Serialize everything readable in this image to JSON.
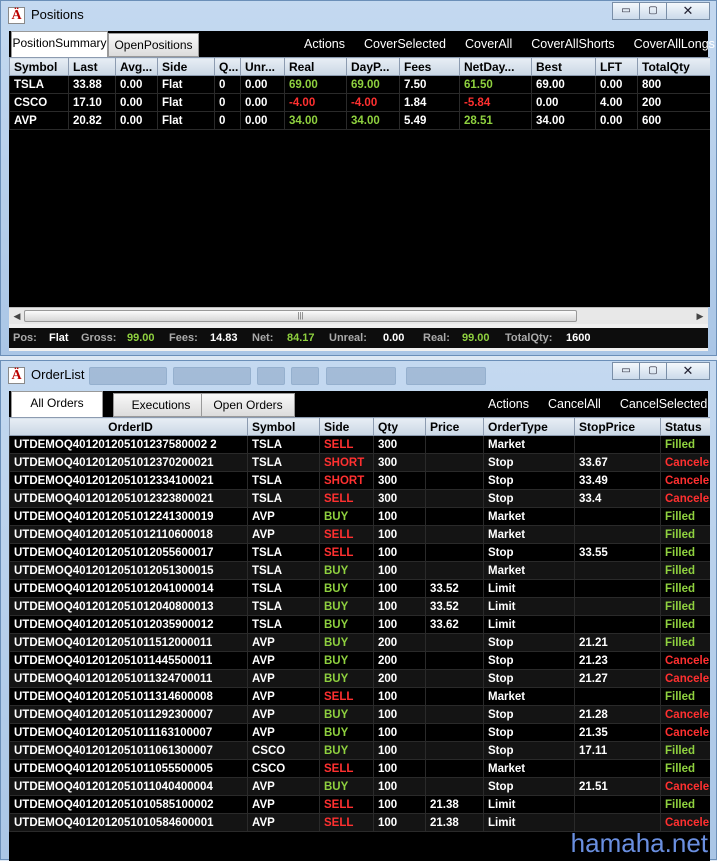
{
  "positions_window": {
    "title": "Positions",
    "app_icon_glyph": "Ä",
    "controls": {
      "minimize": "▭",
      "maximize": "▢",
      "close": "✕"
    },
    "tabs": [
      "PositionSummary",
      "OpenPositions"
    ],
    "actions": [
      "Actions",
      "CoverSelected",
      "CoverAll",
      "CoverAllShorts",
      "CoverAllLongs"
    ],
    "columns": [
      "Symbol",
      "Last",
      "Avg...",
      "Side",
      "Q...",
      "Unr...",
      "Real",
      "DayP...",
      "Fees",
      "NetDay...",
      "Best",
      "LFT",
      "TotalQty"
    ],
    "rows": [
      [
        "TSLA",
        "33.88",
        "0.00",
        "Flat",
        "0",
        "0.00",
        "69.00",
        "69.00",
        "7.50",
        "61.50",
        "69.00",
        "0.00",
        "800"
      ],
      [
        "CSCO",
        "17.10",
        "0.00",
        "Flat",
        "0",
        "0.00",
        "-4.00",
        "-4.00",
        "1.84",
        "-5.84",
        "0.00",
        "4.00",
        "200"
      ],
      [
        "AVP",
        "20.82",
        "0.00",
        "Flat",
        "0",
        "0.00",
        "34.00",
        "34.00",
        "5.49",
        "28.51",
        "34.00",
        "0.00",
        "600"
      ]
    ],
    "status": {
      "pos_label": "Pos:",
      "pos_value": "Flat",
      "gross_label": "Gross:",
      "gross_value": "99.00",
      "fees_label": "Fees:",
      "fees_value": "14.83",
      "net_label": "Net:",
      "net_value": "84.17",
      "unreal_label": "Unreal:",
      "unreal_value": "0.00",
      "real_label": "Real:",
      "real_value": "99.00",
      "totalqty_label": "TotalQty:",
      "totalqty_value": "1600"
    },
    "scroll_grip": "|||"
  },
  "orders_window": {
    "title": "OrderList",
    "app_icon_glyph": "Ä",
    "controls": {
      "minimize": "▭",
      "maximize": "▢",
      "close": "✕"
    },
    "tabs": [
      "All Orders",
      "Executions",
      "Open Orders"
    ],
    "actions": [
      "Actions",
      "CancelAll",
      "CancelSelected"
    ],
    "columns": [
      "OrderID",
      "Symbol",
      "Side",
      "Qty",
      "Price",
      "OrderType",
      "StopPrice",
      "Status"
    ],
    "rows": [
      [
        "UTDEMOQ401201205101237580002 2",
        "TSLA",
        "SELL",
        "300",
        "",
        "Market",
        "",
        "Filled"
      ],
      [
        "UTDEMOQ4012012051012370200021",
        "TSLA",
        "SHORT",
        "300",
        "",
        "Stop",
        "33.67",
        "Cancele"
      ],
      [
        "UTDEMOQ4012012051012334100021",
        "TSLA",
        "SHORT",
        "300",
        "",
        "Stop",
        "33.49",
        "Cancele"
      ],
      [
        "UTDEMOQ4012012051012323800021",
        "TSLA",
        "SELL",
        "300",
        "",
        "Stop",
        "33.4",
        "Cancele"
      ],
      [
        "UTDEMOQ4012012051012241300019",
        "AVP",
        "BUY",
        "100",
        "",
        "Market",
        "",
        "Filled"
      ],
      [
        "UTDEMOQ4012012051012110600018",
        "AVP",
        "SELL",
        "100",
        "",
        "Market",
        "",
        "Filled"
      ],
      [
        "UTDEMOQ4012012051012055600017",
        "TSLA",
        "SELL",
        "100",
        "",
        "Stop",
        "33.55",
        "Filled"
      ],
      [
        "UTDEMOQ4012012051012051300015",
        "TSLA",
        "BUY",
        "100",
        "",
        "Market",
        "",
        "Filled"
      ],
      [
        "UTDEMOQ4012012051012041000014",
        "TSLA",
        "BUY",
        "100",
        "33.52",
        "Limit",
        "",
        "Filled"
      ],
      [
        "UTDEMOQ4012012051012040800013",
        "TSLA",
        "BUY",
        "100",
        "33.52",
        "Limit",
        "",
        "Filled"
      ],
      [
        "UTDEMOQ4012012051012035900012",
        "TSLA",
        "BUY",
        "100",
        "33.62",
        "Limit",
        "",
        "Filled"
      ],
      [
        "UTDEMOQ4012012051011512000011",
        "AVP",
        "BUY",
        "200",
        "",
        "Stop",
        "21.21",
        "Filled"
      ],
      [
        "UTDEMOQ4012012051011445500011",
        "AVP",
        "BUY",
        "200",
        "",
        "Stop",
        "21.23",
        "Cancele"
      ],
      [
        "UTDEMOQ4012012051011324700011",
        "AVP",
        "BUY",
        "200",
        "",
        "Stop",
        "21.27",
        "Cancele"
      ],
      [
        "UTDEMOQ4012012051011314600008",
        "AVP",
        "SELL",
        "100",
        "",
        "Market",
        "",
        "Filled"
      ],
      [
        "UTDEMOQ4012012051011292300007",
        "AVP",
        "BUY",
        "100",
        "",
        "Stop",
        "21.28",
        "Cancele"
      ],
      [
        "UTDEMOQ4012012051011163100007",
        "AVP",
        "BUY",
        "100",
        "",
        "Stop",
        "21.35",
        "Cancele"
      ],
      [
        "UTDEMOQ4012012051011061300007",
        "CSCO",
        "BUY",
        "100",
        "",
        "Stop",
        "17.11",
        "Filled"
      ],
      [
        "UTDEMOQ4012012051011055500005",
        "CSCO",
        "SELL",
        "100",
        "",
        "Market",
        "",
        "Filled"
      ],
      [
        "UTDEMOQ4012012051011040400004",
        "AVP",
        "BUY",
        "100",
        "",
        "Stop",
        "21.51",
        "Cancele"
      ],
      [
        "UTDEMOQ4012012051010585100002",
        "AVP",
        "SELL",
        "100",
        "21.38",
        "Limit",
        "",
        "Filled"
      ],
      [
        "UTDEMOQ4012012051010584600001",
        "AVP",
        "SELL",
        "100",
        "21.38",
        "Limit",
        "",
        "Cancele"
      ]
    ]
  },
  "watermark": "hamaha.net",
  "colors": {
    "positive": "#8fd13f",
    "negative": "#ff3030",
    "grid_bg": "#000000"
  }
}
